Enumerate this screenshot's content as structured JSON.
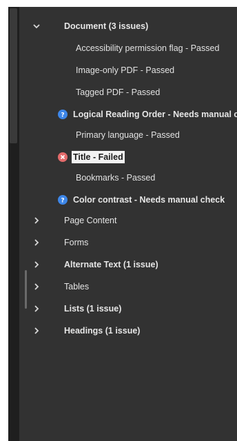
{
  "tree": {
    "document": {
      "label": "Document (3 issues)",
      "children": {
        "accessibility_permission": "Accessibility permission flag - Passed",
        "image_only_pdf": "Image-only PDF - Passed",
        "tagged_pdf": "Tagged PDF - Passed",
        "logical_reading_order": "Logical Reading Order - Needs manual check",
        "primary_language": "Primary language - Passed",
        "title": "Title - Failed",
        "bookmarks": "Bookmarks - Passed",
        "color_contrast": "Color contrast - Needs manual check"
      }
    },
    "sections": {
      "page_content": "Page Content",
      "forms": "Forms",
      "alternate_text": "Alternate Text (1 issue)",
      "tables": "Tables",
      "lists": "Lists (1 issue)",
      "headings": "Headings (1 issue)"
    }
  },
  "icons": {
    "needs_check": "question-icon",
    "failed": "x-icon",
    "expanded": "chevron-down-icon",
    "collapsed": "chevron-right-icon"
  },
  "colors": {
    "panel_bg": "#323232",
    "text": "#e6e6e6",
    "needs_check": "#3d86e8",
    "failed": "#e36b6b"
  }
}
